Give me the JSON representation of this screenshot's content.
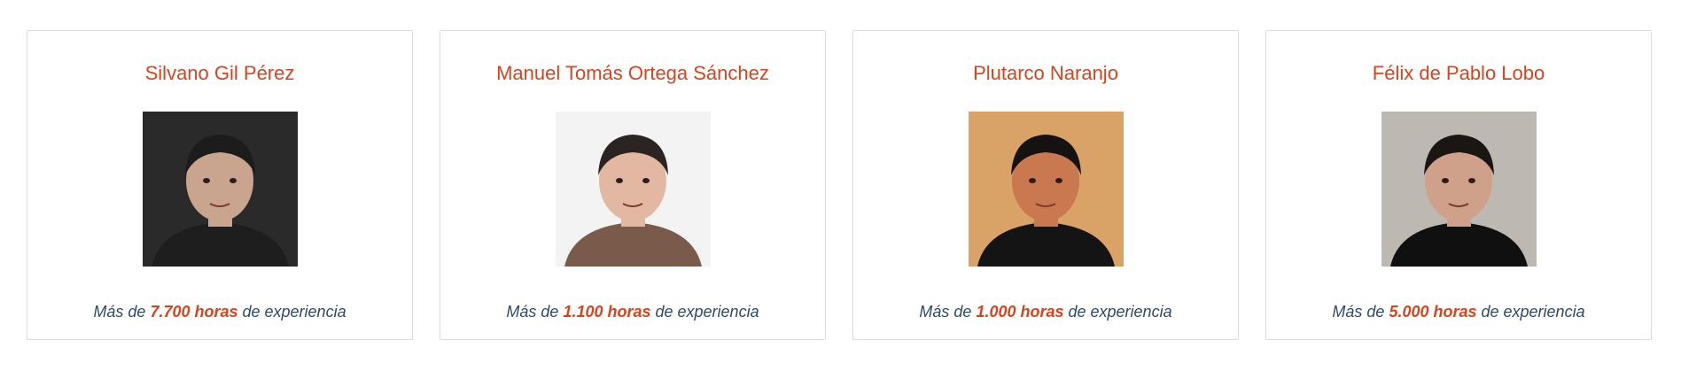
{
  "experts": [
    {
      "name": "Silvano Gil Pérez",
      "photo_icon": "person-portrait-icon",
      "exp_prefix": "Más de ",
      "exp_hours": "7.700 horas",
      "exp_suffix": " de experiencia",
      "photo_bg": "#2a2a2a",
      "skin": "#c9a48e",
      "hair": "#1c1c1c",
      "clothes": "#1e1e1e"
    },
    {
      "name": "Manuel Tomás Ortega Sánchez",
      "photo_icon": "person-portrait-icon",
      "exp_prefix": "Más de ",
      "exp_hours": "1.100 horas",
      "exp_suffix": " de experiencia",
      "photo_bg": "#f3f3f3",
      "skin": "#e2b8a2",
      "hair": "#2a2522",
      "clothes": "#7a5a4a"
    },
    {
      "name": "Plutarco Naranjo",
      "photo_icon": "person-portrait-icon",
      "exp_prefix": "Más de ",
      "exp_hours": "1.000 horas",
      "exp_suffix": " de experiencia",
      "photo_bg": "#d9a266",
      "skin": "#c97850",
      "hair": "#161212",
      "clothes": "#141414"
    },
    {
      "name": "Félix de Pablo Lobo",
      "photo_icon": "person-portrait-icon",
      "exp_prefix": "Más de ",
      "exp_hours": "5.000 horas",
      "exp_suffix": " de experiencia",
      "photo_bg": "#bdb8b2",
      "skin": "#cfa18a",
      "hair": "#1a1614",
      "clothes": "#101010"
    }
  ]
}
